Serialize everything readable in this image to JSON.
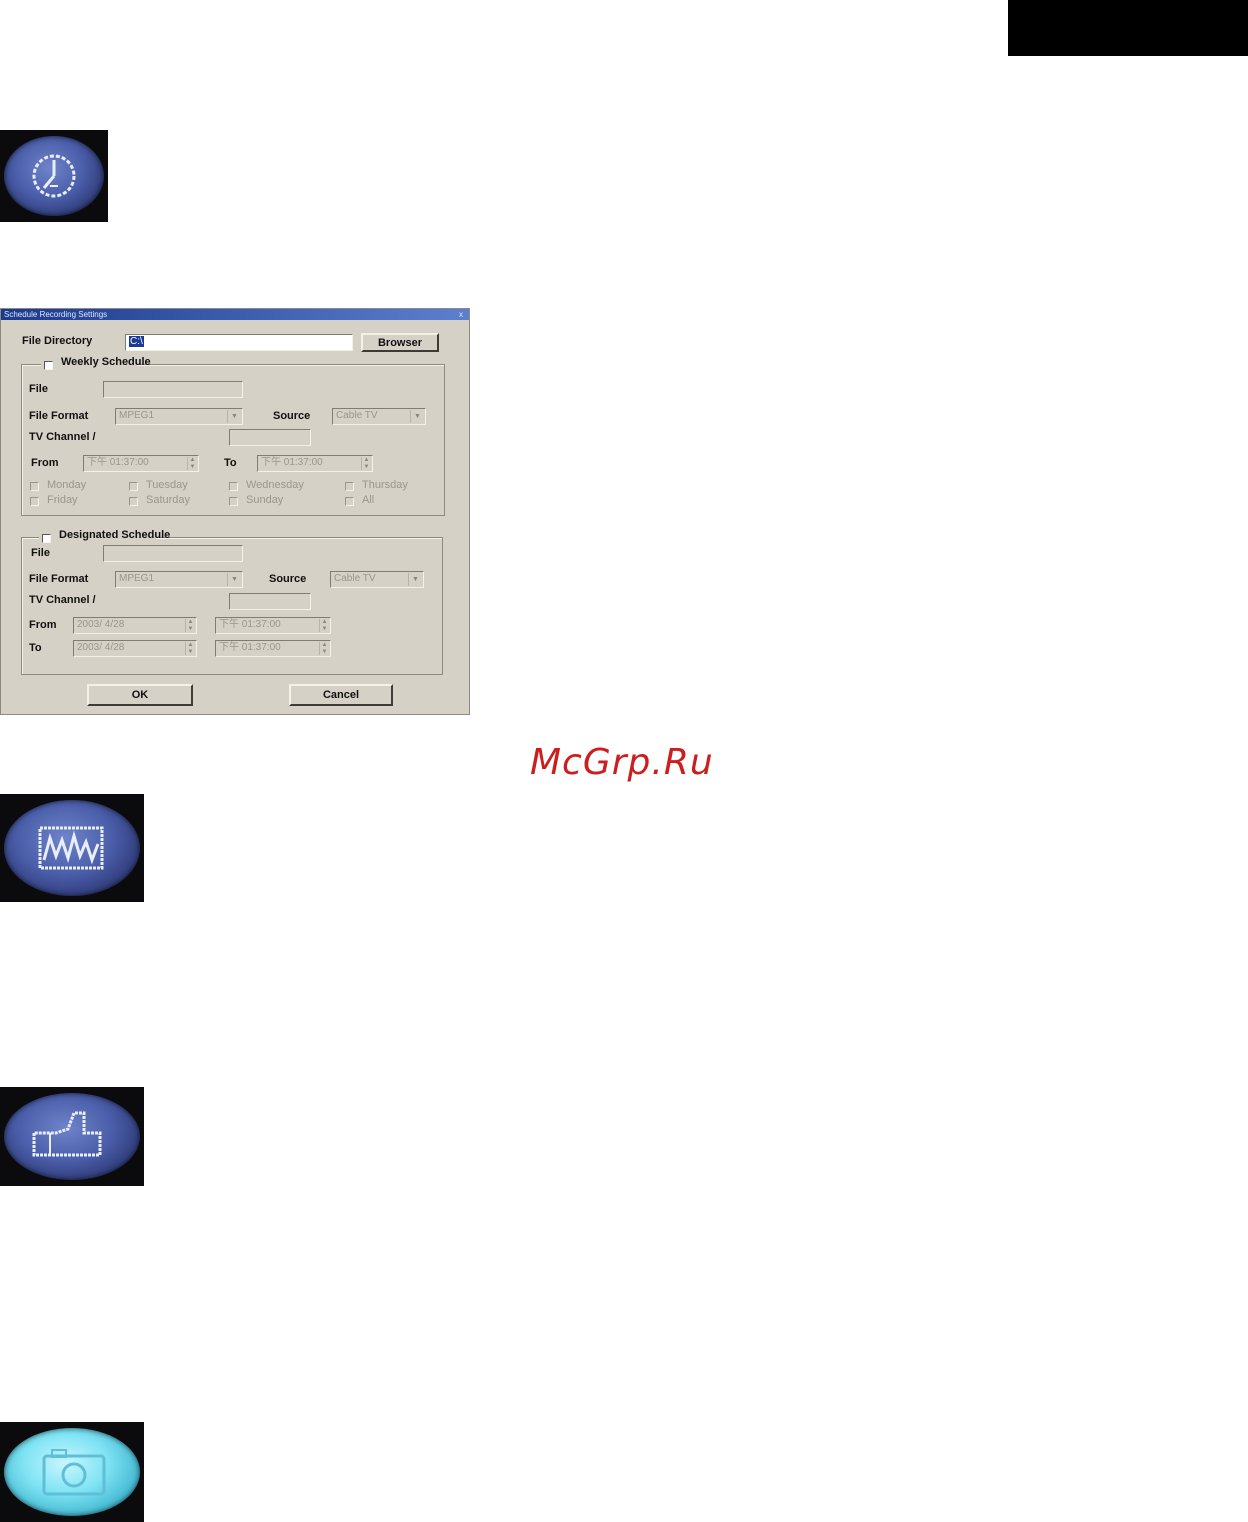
{
  "watermark": "McGrp.Ru",
  "icons": [
    {
      "name": "schedule-clock-icon"
    },
    {
      "name": "equalizer-icon"
    },
    {
      "name": "thumbs-up-icon"
    },
    {
      "name": "camera-icon"
    }
  ],
  "dialog": {
    "title": "Schedule Recording Settings",
    "close_glyph": "x",
    "file_directory_label": "File Directory",
    "file_directory_value": "C:\\",
    "browser_label": "Browser",
    "weekly": {
      "title": "Weekly Schedule",
      "file_label": "File",
      "file_format_label": "File Format",
      "file_format_value": "MPEG1",
      "source_label": "Source",
      "source_value": "Cable TV",
      "tv_channel_label": "TV Channel /",
      "from_label": "From",
      "from_value": "下午 01:37:00",
      "to_label": "To",
      "to_value": "下午 01:37:00",
      "days": [
        "Monday",
        "Tuesday",
        "Wednesday",
        "Thursday",
        "Friday",
        "Saturday",
        "Sunday",
        "All"
      ]
    },
    "designated": {
      "title": "Designated Schedule",
      "file_label": "File",
      "file_format_label": "File Format",
      "file_format_value": "MPEG1",
      "source_label": "Source",
      "source_value": "Cable TV",
      "tv_channel_label": "TV Channel /",
      "from_label": "From",
      "from_date": "2003/ 4/28",
      "from_time": "下午 01:37:00",
      "to_label": "To",
      "to_date": "2003/ 4/28",
      "to_time": "下午 01:37:00"
    },
    "ok_label": "OK",
    "cancel_label": "Cancel"
  }
}
